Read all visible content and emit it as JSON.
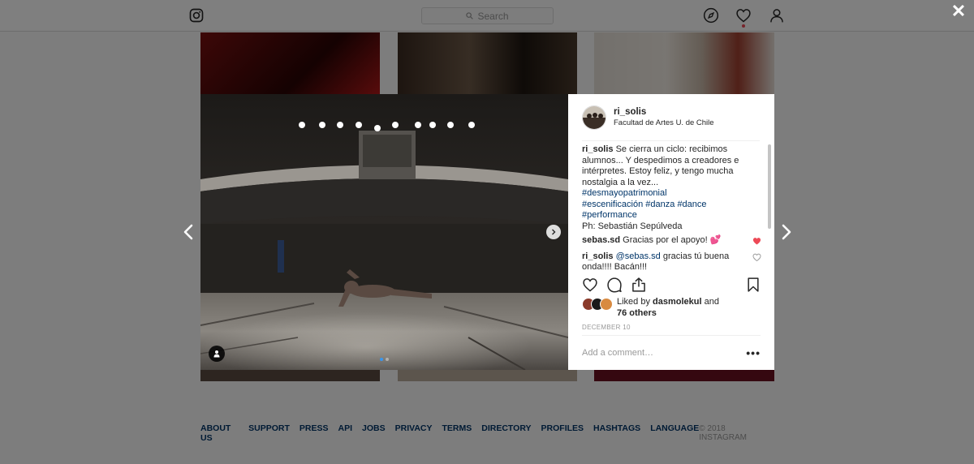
{
  "search": {
    "placeholder": "Search"
  },
  "footer": {
    "links": [
      "About us",
      "Support",
      "Press",
      "API",
      "Jobs",
      "Privacy",
      "Terms",
      "Directory",
      "Profiles",
      "Hashtags",
      "Language"
    ],
    "copyright": "© 2018 Instagram"
  },
  "post": {
    "username": "ri_solis",
    "location": "Facultad de Artes U. de Chile",
    "caption": {
      "user": "ri_solis",
      "text": "Se cierra un ciclo: recibimos alumnos... Y despedimos a creadores e intérpretes. Estoy feliz, y tengo mucha nostalgia a la vez...",
      "tags_line1": "#desmayopatrimonial",
      "tags_line2": [
        "#escenificación",
        "#danza",
        "#dance"
      ],
      "tags_line3": "#performance",
      "credit": "Ph: Sebastián Sepúlveda"
    },
    "comments": [
      {
        "user": "sebas.sd",
        "text": "Gracias por el apoyo! 💕",
        "liked": true
      },
      {
        "user": "ri_solis",
        "mention": "@sebas.sd",
        "text": "gracias tú buena onda!!!! Bacán!!!",
        "liked": false
      }
    ],
    "likes": {
      "prefix": "Liked by",
      "user": "dasmolekul",
      "and": "and",
      "others": "76 others"
    },
    "date": "December 10",
    "add_comment_placeholder": "Add a comment…",
    "more_label": "•••",
    "carousel": {
      "count": 2,
      "active": 0
    }
  },
  "colors": {
    "link": "#003569",
    "heart": "#ed4956",
    "carousel_active": "#3897f0"
  },
  "icons": [
    "instagram-logo-icon",
    "search-icon",
    "compass-icon",
    "heart-icon",
    "profile-icon",
    "close-icon",
    "chevron-left-icon",
    "chevron-right-icon",
    "comment-icon",
    "share-icon",
    "bookmark-icon",
    "user-tag-icon"
  ]
}
